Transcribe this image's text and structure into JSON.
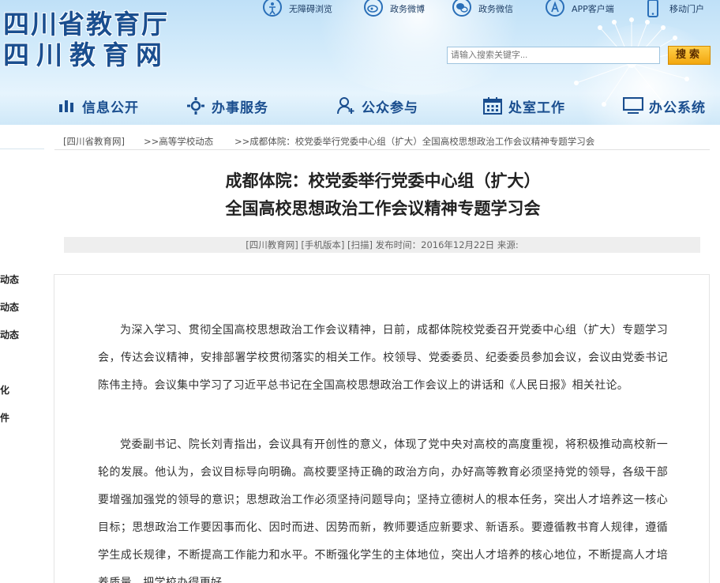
{
  "header": {
    "logo_line1": "四川省教育厅",
    "logo_line2": "四川教育网",
    "top_links": [
      {
        "label": "无障碍浏览",
        "icon": "accessibility-icon"
      },
      {
        "label": "政务微博",
        "icon": "weibo-icon"
      },
      {
        "label": "政务微信",
        "icon": "wechat-icon"
      },
      {
        "label": "APP客户端",
        "icon": "app-store-icon"
      },
      {
        "label": "移动门户",
        "icon": "mobile-icon"
      }
    ],
    "search": {
      "placeholder": "请输入搜索关键字...",
      "button": "搜索"
    }
  },
  "nav": [
    {
      "label": "信息公开",
      "icon": "chart-icon"
    },
    {
      "label": "办事服务",
      "icon": "settings-icon"
    },
    {
      "label": "公众参与",
      "icon": "user-add-icon"
    },
    {
      "label": "处室工作",
      "icon": "calendar-icon"
    },
    {
      "label": "办公系统",
      "icon": "monitor-icon"
    }
  ],
  "sidebar": {
    "items": [
      "动态",
      "动态",
      "动态",
      "化",
      "件"
    ]
  },
  "breadcrumb": [
    "[四川省教育网]",
    ">>高等学校动态",
    ">>成都体院：校党委举行党委中心组（扩大）全国高校思想政治工作会议精神专题学习会"
  ],
  "article": {
    "title_line1": "成都体院：校党委举行党委中心组（扩大）",
    "title_line2": "全国高校思想政治工作会议精神专题学习会",
    "meta": "[四川教育网]  [手机版本]  [扫描]  发布时间：2016年12月22日  来源:",
    "paragraphs": [
      "为深入学习、贯彻全国高校思想政治工作会议精神，日前，成都体院校党委召开党委中心组（扩大）专题学习会，传达会议精神，安排部署学校贯彻落实的相关工作。校领导、党委委员、纪委委员参加会议，会议由党委书记陈伟主持。会议集中学习了习近平总书记在全国高校思想政治工作会议上的讲话和《人民日报》相关社论。",
      "党委副书记、院长刘青指出，会议具有开创性的意义，体现了党中央对高校的高度重视，将积极推动高校新一轮的发展。他认为，会议目标导向明确。高校要坚持正确的政治方向，办好高等教育必须坚持党的领导，各级干部要增强加强党的领导的意识；思想政治工作必须坚持问题导向；坚持立德树人的根本任务，突出人才培养这一核心目标；思想政治工作要因事而化、因时而进、因势而新，教师要适应新要求、新语系。要遵循教书育人规律，遵循学生成长规律，不断提高工作能力和水平。不断强化学生的主体地位，突出人才培养的核心地位，不断提高人才培养质量，把学校办得更好。"
    ]
  },
  "colors": {
    "brand": "#1a4e8f",
    "search_button": "#f2a70e",
    "header_bg": "#cfe8f8"
  }
}
